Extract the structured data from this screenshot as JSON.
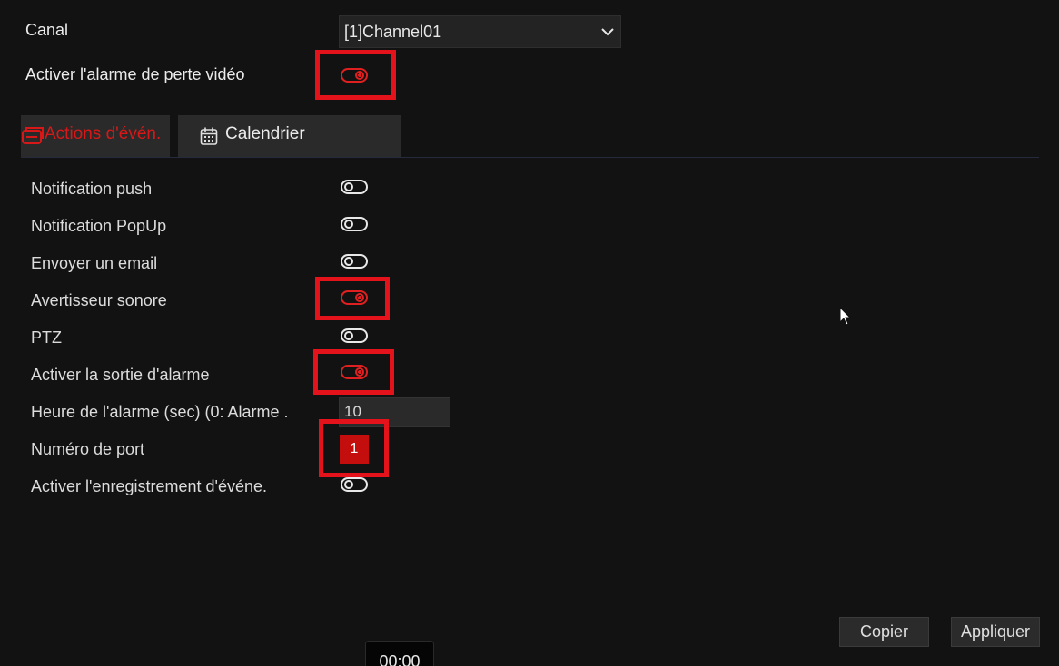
{
  "canal": {
    "label": "Canal",
    "selected": "[1]Channel01"
  },
  "video_loss": {
    "label": "Activer l'alarme de perte vidéo",
    "enabled": true
  },
  "tabs": [
    {
      "label": "Actions d'évén.",
      "active": true
    },
    {
      "label": "Calendrier",
      "active": false
    }
  ],
  "actions": [
    {
      "label": "Notification push",
      "enabled": false
    },
    {
      "label": "Notification PopUp",
      "enabled": false
    },
    {
      "label": "Envoyer un email",
      "enabled": false
    },
    {
      "label": "Avertisseur sonore",
      "enabled": true
    },
    {
      "label": "PTZ",
      "enabled": false
    },
    {
      "label": "Activer la sortie d'alarme",
      "enabled": true
    }
  ],
  "alarm_time": {
    "label": "Heure de l'alarme (sec) (0: Alarme .",
    "value": "10"
  },
  "port": {
    "label": "Numéro de port",
    "value": "1"
  },
  "event_recording": {
    "label": "Activer l'enregistrement d'événe.",
    "enabled": false
  },
  "buttons": {
    "copy": "Copier",
    "apply": "Appliquer"
  },
  "time_chip": "00:00",
  "colors": {
    "accent": "#e02020",
    "highlight": "#e4131b",
    "background": "#121212"
  }
}
